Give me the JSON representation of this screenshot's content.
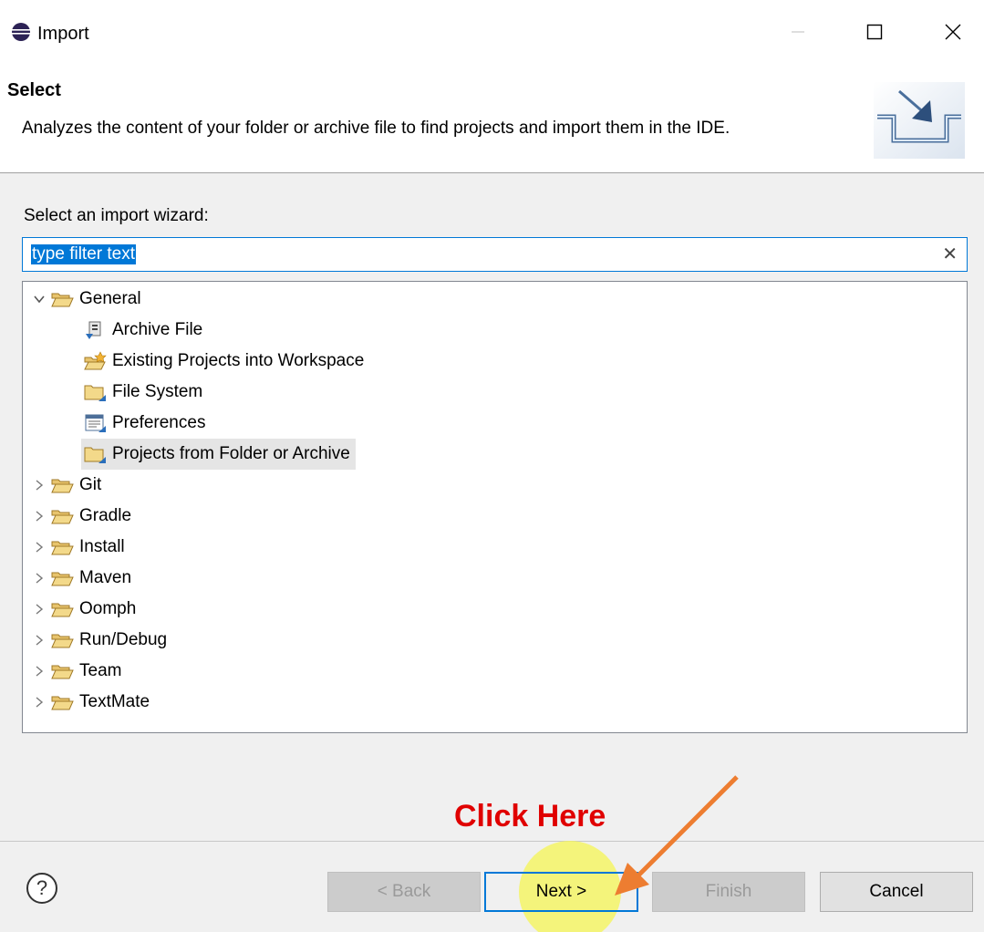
{
  "window": {
    "title": "Import",
    "icon": "eclipse-icon",
    "controls": [
      "minimize-icon",
      "maximize-icon",
      "close-icon"
    ]
  },
  "header": {
    "title": "Select",
    "description": "Analyzes the content of your folder or archive file to find projects and import them in the IDE.",
    "banner_icon": "import-wizard-banner-icon"
  },
  "wizard": {
    "label": "Select an import wizard:",
    "filter": {
      "value": "type filter text",
      "clear_icon": "clear-icon"
    }
  },
  "tree": {
    "general": {
      "label": "General",
      "expanded": true,
      "children": [
        {
          "label": "Archive File",
          "icon": "archive-file-icon"
        },
        {
          "label": "Existing Projects into Workspace",
          "icon": "existing-projects-icon"
        },
        {
          "label": "File System",
          "icon": "folder-icon"
        },
        {
          "label": "Preferences",
          "icon": "preferences-icon"
        },
        {
          "label": "Projects from Folder or Archive",
          "icon": "folder-icon",
          "selected": true
        }
      ]
    },
    "collapsed": [
      "Git",
      "Gradle",
      "Install",
      "Maven",
      "Oomph",
      "Run/Debug",
      "Team",
      "TextMate"
    ]
  },
  "buttons": {
    "back": "< Back",
    "next": "Next >",
    "finish": "Finish",
    "cancel": "Cancel"
  },
  "annotation": {
    "text": "Click Here",
    "color": "#e00000",
    "arrow_color": "#ed7d31",
    "highlight_color": "#f5f55a"
  },
  "colors": {
    "accent": "#0078d7",
    "selection": "#e5e5e5",
    "folder": "#dcb67a"
  }
}
